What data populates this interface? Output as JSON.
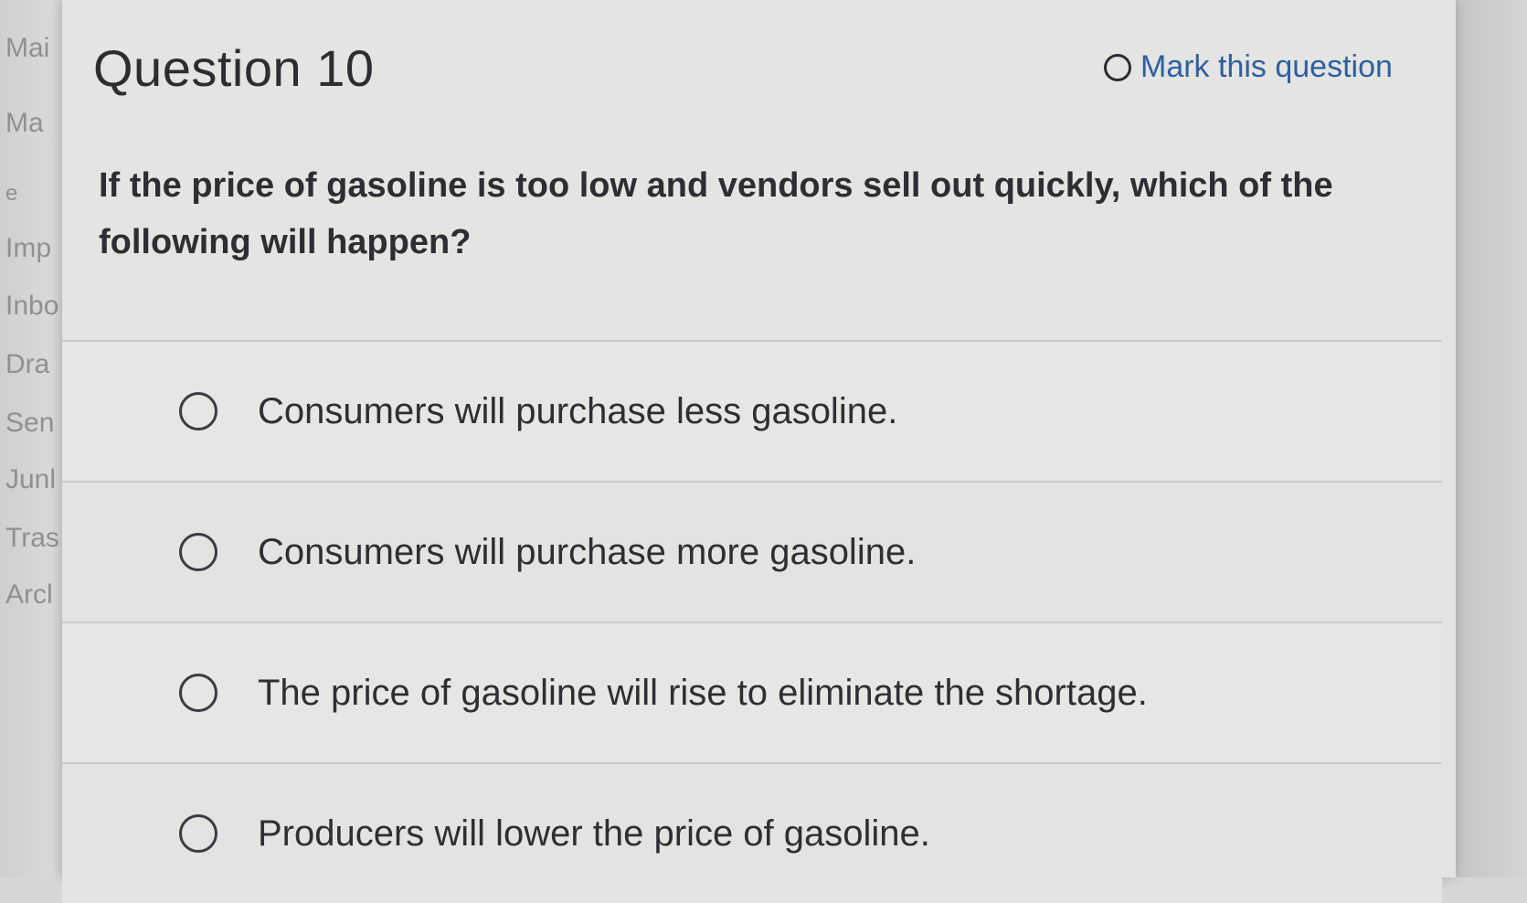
{
  "sidebar": {
    "items": [
      "Mai",
      "Ma",
      "e",
      "Imp",
      "Inbo",
      "Dra",
      "Sen",
      "Junl",
      "Tras",
      "Arcl"
    ]
  },
  "question": {
    "title": "Question 10",
    "mark_label": "Mark this question",
    "text": "If the price of gasoline is too low and vendors sell out quickly, which of the following will happen?",
    "options": [
      "Consumers will purchase less gasoline.",
      "Consumers will purchase more gasoline.",
      "The price of gasoline will rise to eliminate the shortage.",
      "Producers will lower the price of gasoline."
    ]
  },
  "colors": {
    "link": "#2f5f9e",
    "text": "#2d2e33",
    "panel": "#e4e4e2"
  }
}
